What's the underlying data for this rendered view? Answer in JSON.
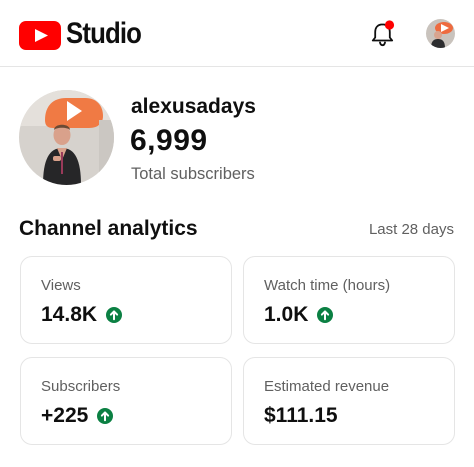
{
  "header": {
    "app_title": "Studio",
    "logo_icon": "youtube-logo-icon",
    "notifications_icon": "bell-icon",
    "notification_dot_color": "#ff0000",
    "account_icon": "account-avatar"
  },
  "channel": {
    "name": "alexusadays",
    "subscriber_count": "6,999",
    "subscriber_label": "Total subscribers"
  },
  "analytics": {
    "title": "Channel analytics",
    "range": "Last 28 days",
    "trend_color": "#0b8043",
    "cards": [
      {
        "label": "Views",
        "value": "14.8K",
        "trend": "up"
      },
      {
        "label": "Watch time (hours)",
        "value": "1.0K",
        "trend": "up"
      },
      {
        "label": "Subscribers",
        "value": "+225",
        "trend": "up"
      },
      {
        "label": "Estimated revenue",
        "value": "$111.15",
        "trend": "none"
      }
    ]
  },
  "colors": {
    "brand_red": "#ff0000",
    "text_primary": "#0f0f0f",
    "text_secondary": "#606060",
    "border": "#e5e5e5"
  }
}
